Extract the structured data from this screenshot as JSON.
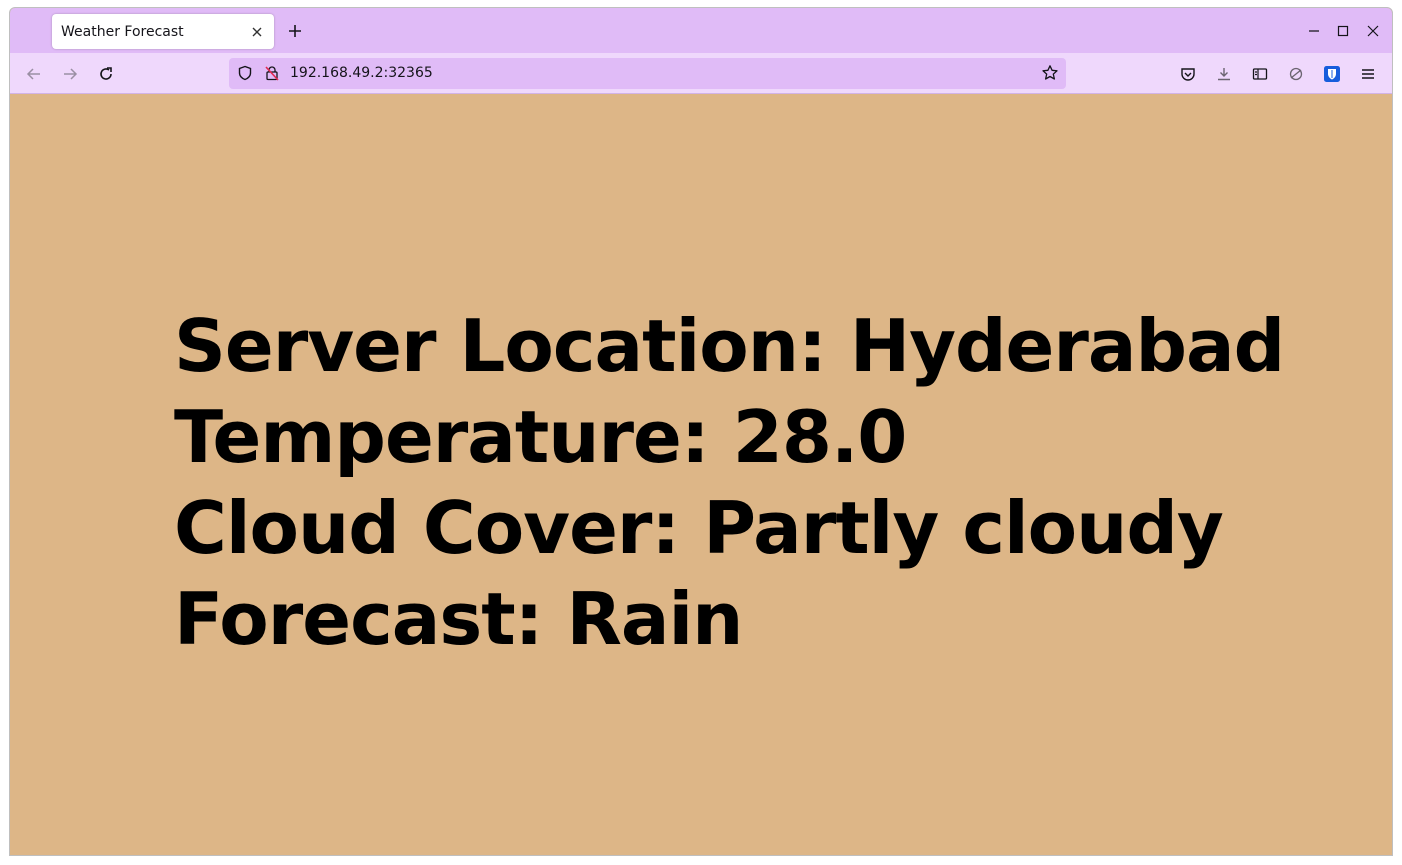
{
  "browser": {
    "tab": {
      "title": "Weather Forecast"
    },
    "url": "192.168.49.2:32365",
    "colors": {
      "tabbar": "#e0bbf7",
      "navbar": "#efd8fc",
      "page_background": "#ddb687"
    }
  },
  "page": {
    "lines": [
      "Server Location: Hyderabad",
      "Temperature: 28.0",
      "Cloud Cover: Partly cloudy",
      "Forecast: Rain"
    ]
  },
  "icons": {
    "tab_close": "close-icon",
    "new_tab": "plus-icon",
    "minimize": "minimize-icon",
    "maximize": "maximize-icon",
    "close_window": "close-icon",
    "back": "arrow-left-icon",
    "forward": "arrow-right-icon",
    "reload": "reload-icon",
    "tracking_protection": "shield-icon",
    "insecure": "insecure-lock-icon",
    "bookmark": "star-icon",
    "pocket": "pocket-icon",
    "downloads": "download-icon",
    "sidebar": "sidebar-icon",
    "extension": "extension-icon",
    "bitwarden": "bitwarden-icon",
    "menu": "hamburger-icon"
  }
}
